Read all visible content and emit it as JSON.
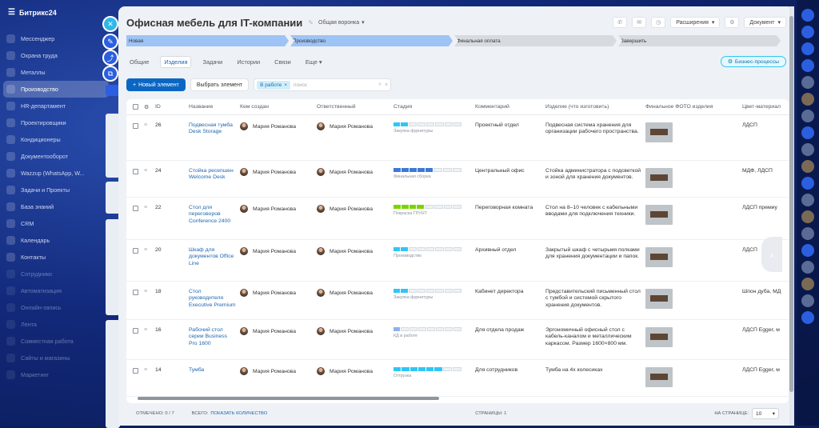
{
  "app": {
    "name": "Битрикс24"
  },
  "menu": [
    {
      "label": "Мессенджер"
    },
    {
      "label": "Охрана труда"
    },
    {
      "label": "Металлы"
    },
    {
      "label": "Производство"
    },
    {
      "label": "HR-департамент"
    },
    {
      "label": "Проектировщики"
    },
    {
      "label": "Кондиционеры"
    },
    {
      "label": "Документооборот"
    },
    {
      "label": "Wazzup (WhatsApp, W..."
    },
    {
      "label": "Задачи и Проекты"
    },
    {
      "label": "База знаний"
    },
    {
      "label": "CRM"
    },
    {
      "label": "Календарь"
    },
    {
      "label": "Контакты"
    },
    {
      "label": "Сотрудники"
    },
    {
      "label": "Автоматизация"
    },
    {
      "label": "Онлайн-запись"
    },
    {
      "label": "Лента"
    },
    {
      "label": "Совместная работа"
    },
    {
      "label": "Сайты и магазины"
    },
    {
      "label": "Маркетинг"
    }
  ],
  "header": {
    "title": "Офисная мебель для IT-компании",
    "funnel": "Общая воронка",
    "extensions": "Расширения",
    "document": "Документ"
  },
  "stages": [
    {
      "label": "Новая",
      "color": "#9ec3f5"
    },
    {
      "label": "Производство",
      "color": "#9ec3f5"
    },
    {
      "label": "Финальная оплата",
      "color": "#d7dbe0"
    },
    {
      "label": "Завершить",
      "color": "#d7dbe0"
    }
  ],
  "tabs": [
    {
      "label": "Общие"
    },
    {
      "label": "Изделия"
    },
    {
      "label": "Задачи"
    },
    {
      "label": "Истории"
    },
    {
      "label": "Связи"
    },
    {
      "label": "Еще"
    }
  ],
  "business_processes": "Бизнес-процессы",
  "toolbar": {
    "new_element": "Новый элемент",
    "select_element": "Выбрать элемент",
    "filter_chip": "В работе",
    "search_placeholder": "поиск"
  },
  "columns": [
    "ID",
    "Название",
    "Кем создан",
    "Ответственный",
    "Стадия",
    "Комментарий",
    "Изделие (что изготовить)",
    "Финальное ФОТО изделия",
    "Цвет-материал"
  ],
  "rows": [
    {
      "id": "26",
      "name": "Подвесная тумба Desk Storage",
      "created_by": "Мария Романова",
      "responsible": "Мария Романова",
      "stage": "Закупка фурнитуры",
      "stage_progress": 0.22,
      "stage_color": "#2fc6f6",
      "comment": "Проектный отдел",
      "product": "Подвесная система хранения для организации рабочего пространства.",
      "material": "ЛДСП"
    },
    {
      "id": "24",
      "name": "Стойка ресепшен Welcome Desk",
      "created_by": "Мария Романова",
      "responsible": "Мария Романова",
      "stage": "Финальная сборка",
      "stage_progress": 0.67,
      "stage_color": "#3d78d8",
      "comment": "Центральный офис",
      "product": "Стойка администратора с подсветкой и зоной для хранения документов.",
      "material": "МДФ, ЛДСП"
    },
    {
      "id": "22",
      "name": "Стол для переговоров Conference 2400",
      "created_by": "Мария Романова",
      "responsible": "Мария Романова",
      "stage": "Покраска ГРУНТ",
      "stage_progress": 0.44,
      "stage_color": "#7bd500",
      "comment": "Переговорная комната",
      "product": "Стол на 8–10 человек с кабельными вводами для подключения техники.",
      "material": "ЛДСП премиу"
    },
    {
      "id": "20",
      "name": "Шкаф для документов Office Line",
      "created_by": "Мария Романова",
      "responsible": "Мария Романова",
      "stage": "Производство",
      "stage_progress": 0.22,
      "stage_color": "#2fc6f6",
      "comment": "Архивный отдел",
      "product": "Закрытый шкаф с четырьмя полками для хранения документации и папок.",
      "material": "ЛДСП"
    },
    {
      "id": "18",
      "name": "Стол руководителя Executive Premium",
      "created_by": "Мария Романова",
      "responsible": "Мария Романова",
      "stage": "Закупка фурнитуры",
      "stage_progress": 0.22,
      "stage_color": "#2fc6f6",
      "comment": "Кабинет директора",
      "product": "Представительский письменный стол с тумбой и системой скрытого хранения документов.",
      "material": "Шпон дуба, МД"
    },
    {
      "id": "16",
      "name": "Рабочий стол серии Business Pro 1600",
      "created_by": "Мария Романова",
      "responsible": "Мария Романова",
      "stage": "КД в работе",
      "stage_progress": 0.11,
      "stage_color": "#8fb0f0",
      "comment": "Для отдела продаж",
      "product": "Эргономичный офисный стол с кабель-каналом и металлическим каркасом. Размер 1600×800 мм.",
      "material": "ЛДСП Egger, м"
    },
    {
      "id": "14",
      "name": "Тумба",
      "created_by": "Мария Романова",
      "responsible": "Мария Романова",
      "stage": "Отгрузка",
      "stage_progress": 0.78,
      "stage_color": "#2fc6f6",
      "comment": "Для сотрудников",
      "product": "Тумба на 4х колесиках",
      "material": "ЛДСП Egger, м"
    }
  ],
  "footer": {
    "selected": "ОТМЕЧЕНО: 0 / 7",
    "total": "ВСЕГО:",
    "show_count": "ПОКАЗАТЬ КОЛИЧЕСТВО",
    "pages": "СТРАНИЦЫ: 1",
    "per_page_label": "НА СТРАНИЦЕ:",
    "per_page": "10"
  }
}
